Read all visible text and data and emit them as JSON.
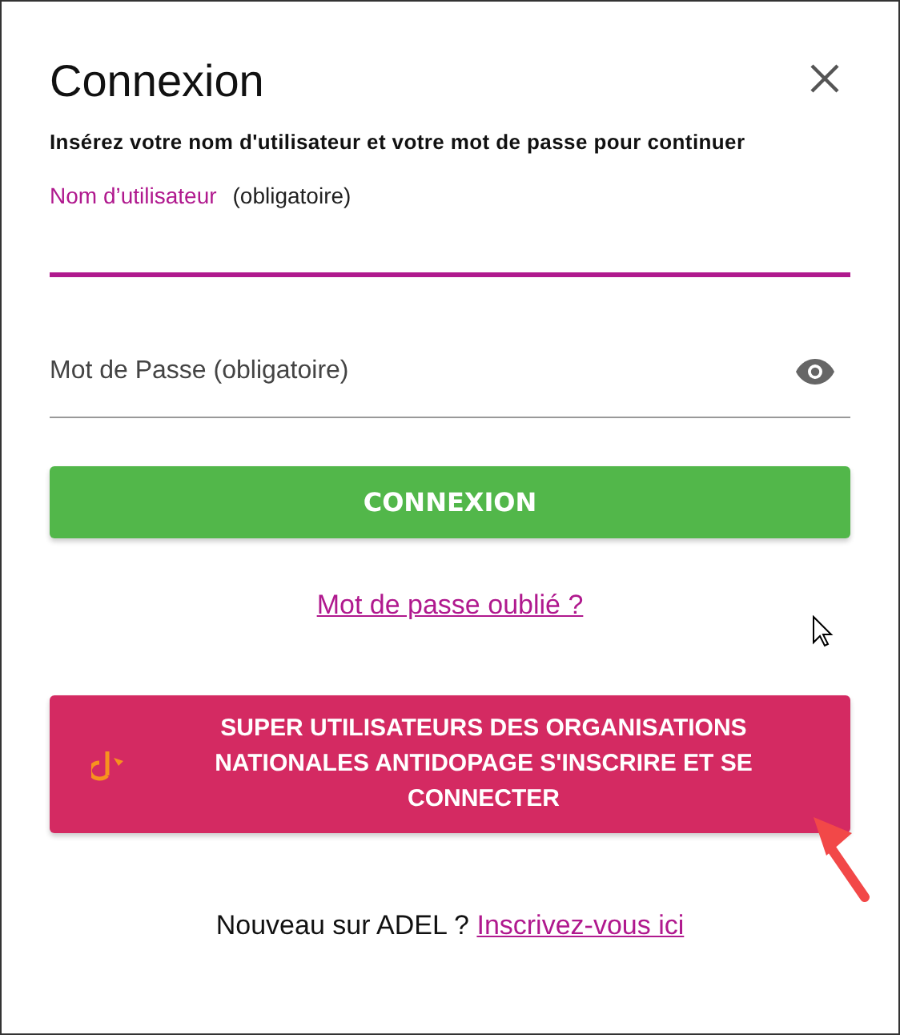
{
  "dialog": {
    "title": "Connexion",
    "subtitle": "Insérez votre nom d'utilisateur et votre mot de passe pour continuer"
  },
  "fields": [
    {
      "kind": "text",
      "label": "Nom d’utilisateur",
      "hint": "(obligatoire)",
      "focused": true
    },
    {
      "kind": "password",
      "placeholder": "Mot de Passe (obligatoire)",
      "focused": false
    }
  ],
  "login_button": "CONNEXION",
  "forgot_link": "Mot de passe oublié ?",
  "super_user_button": "SUPER UTILISATEURS DES ORGANISATIONS NATIONALES ANTIDOPAGE S'INSCRIRE ET SE CONNECTER",
  "footer": {
    "text": "Nouveau sur ADEL ?",
    "link": "Inscrivez-vous ici"
  }
}
